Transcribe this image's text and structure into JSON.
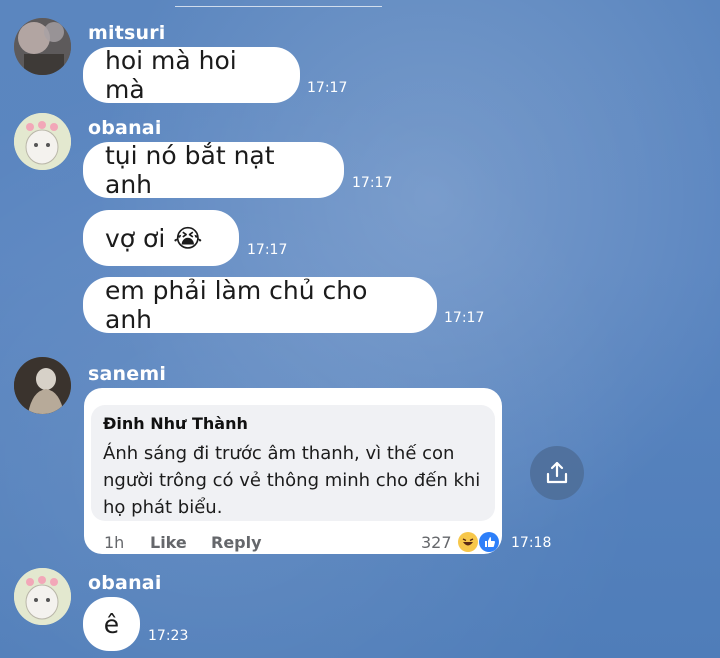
{
  "messages": [
    {
      "sender": "mitsuri",
      "text": "hoi mà hoi mà",
      "time": "17:17"
    },
    {
      "sender": "obanai",
      "texts": [
        {
          "text": "tụi nó bắt nạt anh",
          "time": "17:17"
        },
        {
          "text": "vợ ơi 😭",
          "time": "17:17"
        },
        {
          "text": "em phải làm chủ cho anh",
          "time": "17:17"
        }
      ]
    },
    {
      "sender": "sanemi",
      "time": "17:18",
      "screenshot": {
        "author": "Đinh Như Thành",
        "body": "Ánh sáng đi trước âm thanh, vì thế con người trông có vẻ thông minh cho đến khi họ phát biểu.",
        "age": "1h",
        "like": "Like",
        "reply": "Reply",
        "reaction_count": "327"
      }
    },
    {
      "sender": "obanai",
      "text": "ê",
      "time": "17:23"
    }
  ],
  "icons": {
    "share": "share-icon",
    "haha": "haha-reaction-icon",
    "like": "like-reaction-icon"
  },
  "colors": {
    "background": "#5a85c0",
    "bubble": "#ffffff",
    "accent_share": "#4d6d98"
  }
}
